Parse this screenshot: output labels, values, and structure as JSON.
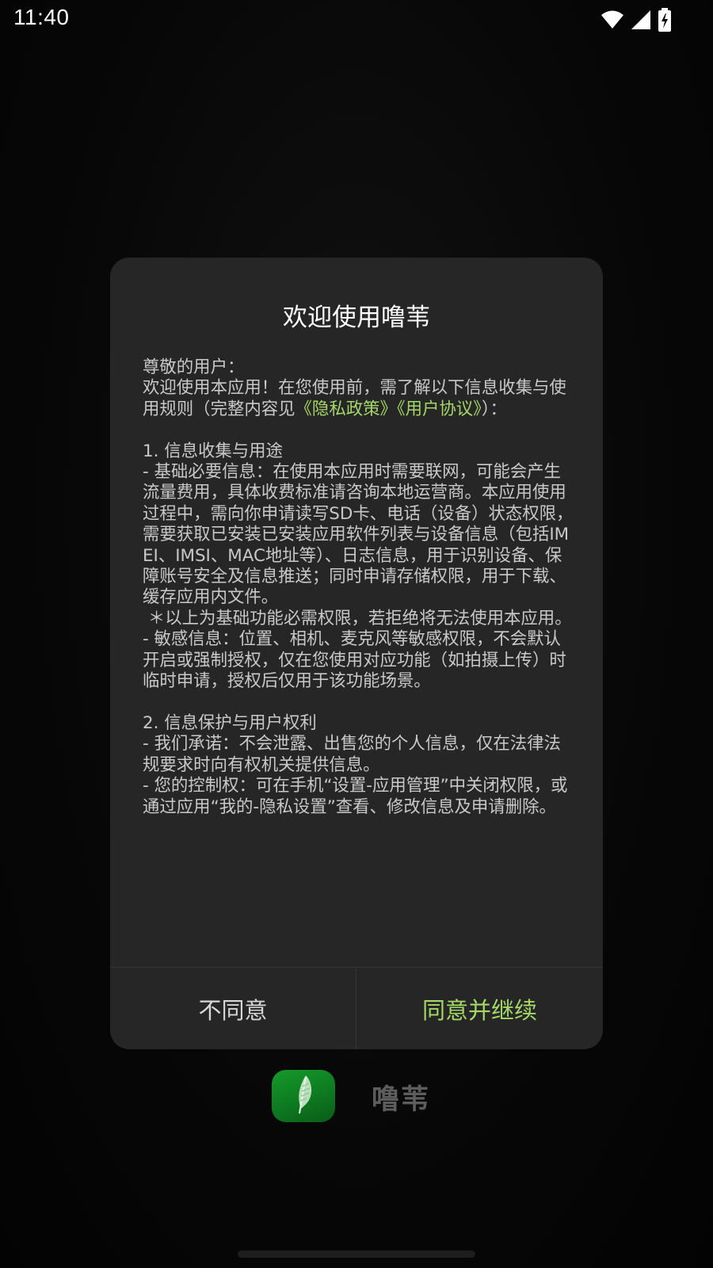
{
  "status_bar": {
    "time": "11:40",
    "icons": [
      "wifi-icon",
      "cellular-signal-icon",
      "battery-charging-icon"
    ]
  },
  "dialog": {
    "title": "欢迎使用噜苇",
    "greeting": "尊敬的用户：",
    "intro_before_links": "欢迎使用本应用！在您使用前，需了解以下信息收集与使用规则（完整内容见",
    "privacy_link": "《隐私政策》",
    "terms_link": "《用户协议》",
    "intro_after_links": "）：",
    "section1_heading": "1. 信息收集与用途",
    "section1_basic": "- 基础必要信息：在使用本应用时需要联网，可能会产生流量费用，具体收费标准请咨询本地运营商。本应用使用过程中，需向你申请读写SD卡、电话（设备）状态权限，需要获取已安装已安装应用软件列表与设备信息（包括IMEI、IMSI、MAC地址等）、日志信息，用于识别设备、保障账号安全及信息推送；同时申请存储权限，用于下载、缓存应用内文件。",
    "section1_note": " ＊以上为基础功能必需权限，若拒绝将无法使用本应用。",
    "section1_sensitive": "- 敏感信息：位置、相机、麦克风等敏感权限，不会默认开启或强制授权，仅在您使用对应功能（如拍摄上传）时临时申请，授权后仅用于该功能场景。",
    "section2_heading": "2. 信息保护与用户权利",
    "section2_promise": "- 我们承诺：不会泄露、出售您的个人信息，仅在法律法规要求时向有权机关提供信息。",
    "section2_control": "- 您的控制权：可在手机“设置-应用管理”中关闭权限，或通过应用“我的-隐私设置”查看、修改信息及申请删除。",
    "disagree_label": "不同意",
    "agree_label": "同意并继续"
  },
  "splash": {
    "app_name": "噜苇",
    "logo_icon": "reed-feather-icon"
  },
  "colors": {
    "accent": "#a6d867",
    "dialog_bg": "#262626",
    "logo_green": "#169a2b"
  }
}
